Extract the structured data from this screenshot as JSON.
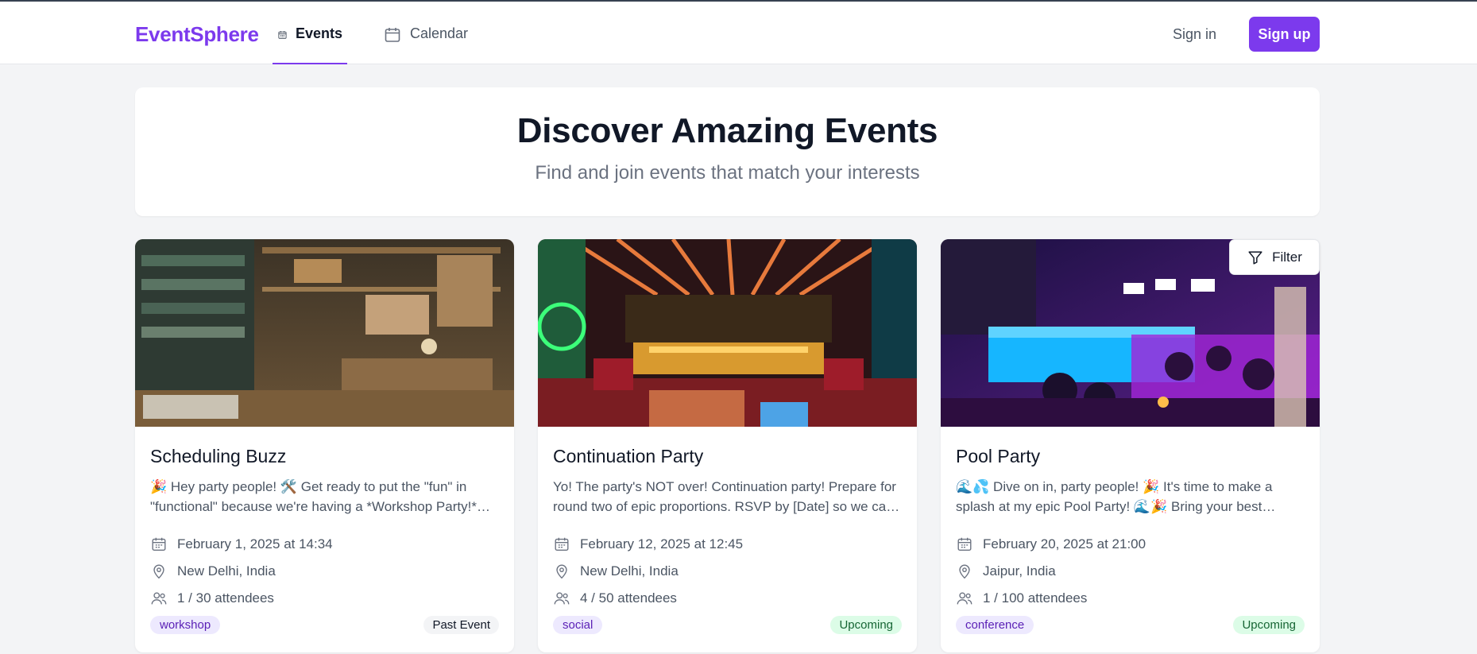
{
  "header": {
    "brand": "EventSphere",
    "nav": [
      {
        "label": "Events",
        "icon": "calendar-icon",
        "active": true
      },
      {
        "label": "Calendar",
        "icon": "calendar-icon",
        "active": false
      }
    ],
    "sign_in": "Sign in",
    "sign_up": "Sign up"
  },
  "hero": {
    "title": "Discover Amazing Events",
    "subtitle": "Find and join events that match your interests"
  },
  "filter": {
    "label": "Filter",
    "icon": "filter-icon"
  },
  "events": [
    {
      "title": "Scheduling Buzz",
      "description": "🎉 Hey party people! 🛠️ Get ready to put the \"fun\" in \"functional\" because we're having a *Workshop Party!* Bring your tools, your ideas and your best attitude.",
      "date": "February 1, 2025 at 14:34",
      "location": "New Delhi, India",
      "attendees": "1 / 30 attendees",
      "tag": "workshop",
      "status": "Past Event"
    },
    {
      "title": "Continuation Party",
      "description": "Yo! The party's NOT over! Continuation party! Prepare for round two of epic proportions. RSVP by [Date] so we can get ready for you.",
      "date": "February 12, 2025 at 12:45",
      "location": "New Delhi, India",
      "attendees": "4 / 50 attendees",
      "tag": "social",
      "status": "Upcoming"
    },
    {
      "title": "Pool Party",
      "description": "🌊💦 Dive on in, party people! 🎉 It's time to make a splash at my epic Pool Party! 🌊🎉 Bring your best floaties and your sunniest smile.",
      "date": "February 20, 2025 at 21:00",
      "location": "Jaipur, India",
      "attendees": "1 / 100 attendees",
      "tag": "conference",
      "status": "Upcoming"
    }
  ],
  "colors": {
    "accent": "#7c3aed",
    "upcoming_bg": "#dcfce7",
    "upcoming_text": "#166534",
    "tag_bg": "#ede9fe"
  }
}
